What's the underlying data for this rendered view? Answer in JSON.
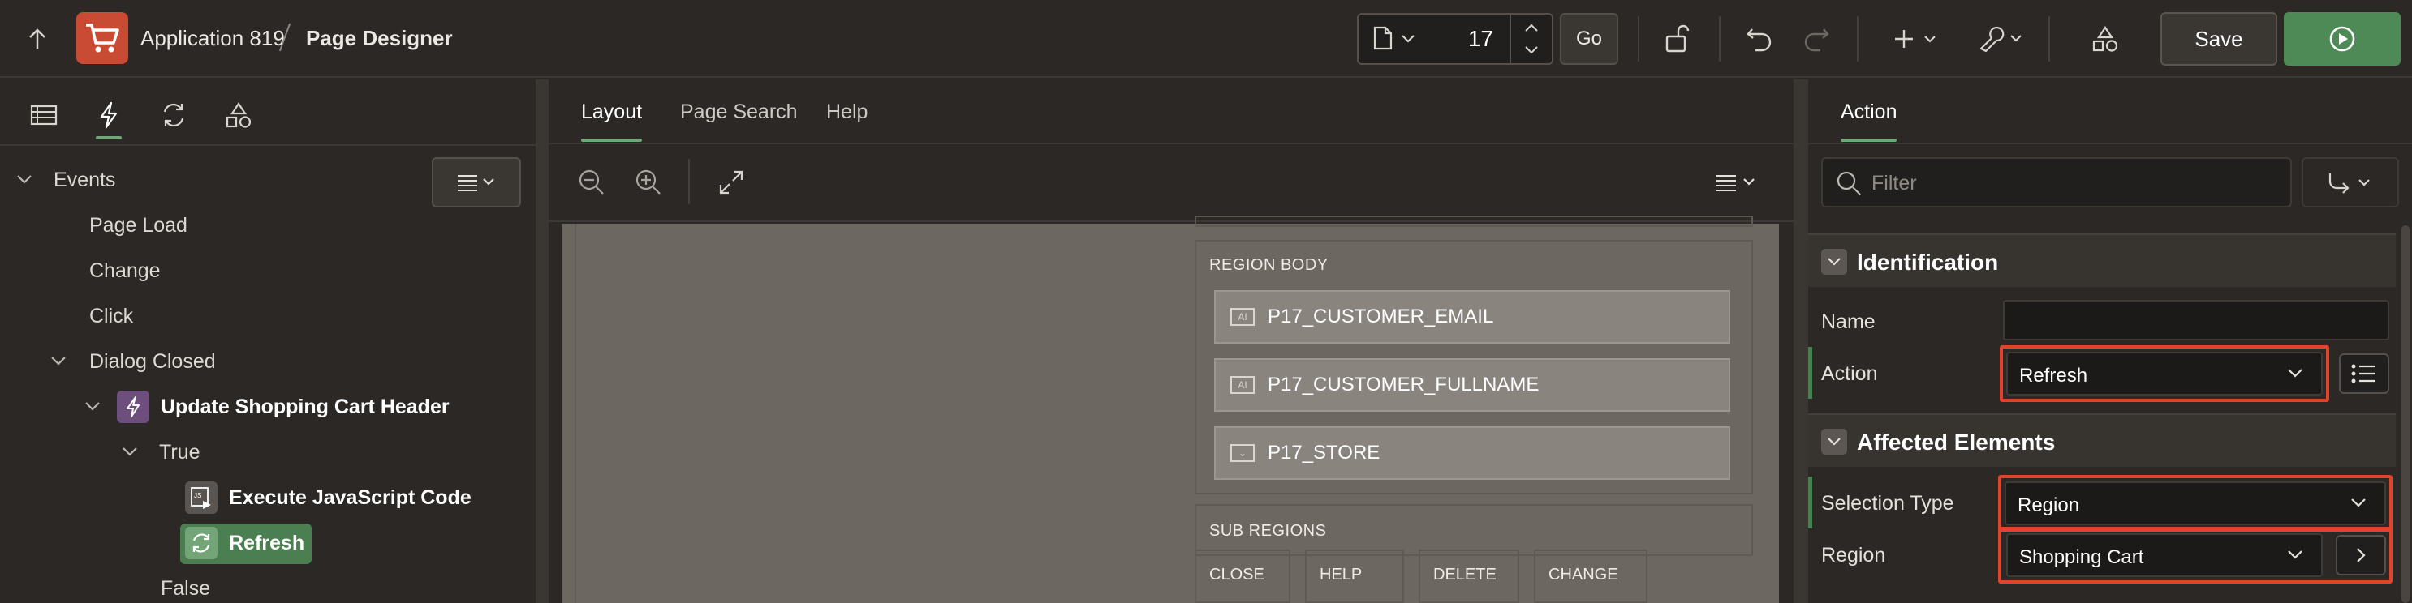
{
  "header": {
    "app_name": "Application 819",
    "page_title": "Page Designer",
    "page_number": "17",
    "go_label": "Go",
    "save_label": "Save"
  },
  "left_pane": {
    "tree": {
      "events": "Events",
      "page_load": "Page Load",
      "change": "Change",
      "click": "Click",
      "dialog_closed": "Dialog Closed",
      "dynamic_action": "Update Shopping Cart Header",
      "true_branch": "True",
      "action_execute_js": "Execute JavaScript Code",
      "action_refresh": "Refresh",
      "false_branch": "False"
    }
  },
  "center": {
    "tabs": [
      "Layout",
      "Page Search",
      "Help"
    ],
    "region_body_label": "REGION BODY",
    "items": [
      "P17_CUSTOMER_EMAIL",
      "P17_CUSTOMER_FULLNAME",
      "P17_STORE"
    ],
    "sub_regions_label": "SUB REGIONS",
    "buttons": [
      "CLOSE",
      "HELP",
      "DELETE",
      "CHANGE"
    ]
  },
  "right_pane": {
    "tab": "Action",
    "filter_placeholder": "Filter",
    "identification": {
      "title": "Identification",
      "name_label": "Name",
      "name_value": "",
      "action_label": "Action",
      "action_value": "Refresh"
    },
    "affected_elements": {
      "title": "Affected Elements",
      "selection_type_label": "Selection Type",
      "selection_type_value": "Region",
      "region_label": "Region",
      "region_value": "Shopping Cart"
    }
  },
  "colors": {
    "accent_green": "#4d8a55",
    "app_icon_red": "#c94b34",
    "highlight_red": "#e2432a",
    "background": "#2b2825"
  }
}
